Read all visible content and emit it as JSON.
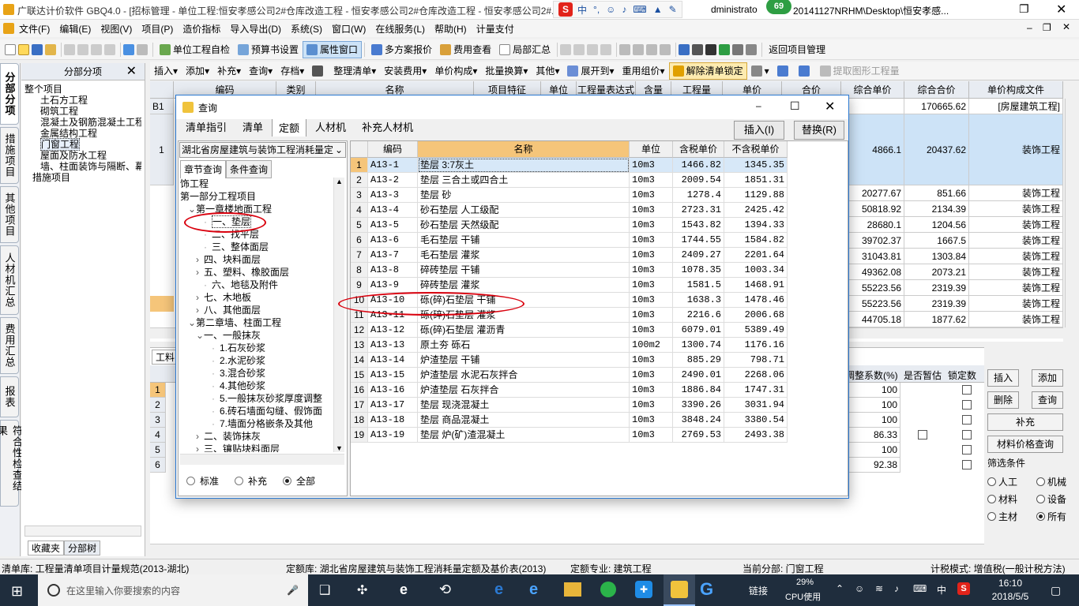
{
  "app": {
    "title": "广联达计价软件 GBQ4.0 - [招标管理 - 单位工程:恒安孝感公司2#仓库改造工程 - 恒安孝感公司2#仓库改造工程 - 恒安孝感公司2#...",
    "title_tail": "dministrato",
    "title_path": "20141127NRHM\\Desktop\\恒安孝感...",
    "badge": "69"
  },
  "menu": [
    "文件(F)",
    "编辑(E)",
    "视图(V)",
    "项目(P)",
    "造价指标",
    "导入导出(D)",
    "系统(S)",
    "窗口(W)",
    "在线服务(L)",
    "帮助(H)",
    "计量支付"
  ],
  "toolbar1": [
    "单位工程自检",
    "预算书设置",
    "属性窗口",
    "多方案报价",
    "费用查看",
    "局部汇总",
    "返回项目管理"
  ],
  "toolbar2": [
    "插入",
    "添加",
    "补充",
    "查询",
    "存档",
    "整理清单",
    "安装费用",
    "单价构成",
    "批量换算",
    "其他",
    "展开到",
    "重用组价",
    "解除清单锁定",
    "提取图形工程量"
  ],
  "vtabs": [
    "分部分项",
    "措施项目",
    "其他项目",
    "人材机汇总",
    "费用汇总",
    "报表",
    "符合性检查结果"
  ],
  "nav": {
    "header": "分部分项",
    "items": [
      "整个项目",
      "土石方工程",
      "砌筑工程",
      "混凝土及钢筋混凝土工程",
      "金属结构工程",
      "门窗工程",
      "屋面及防水工程",
      "墙、柱面装饰与隔断、幕墙工程",
      "措施项目"
    ],
    "bottom_tabs": [
      "收藏夹",
      "分部树"
    ]
  },
  "main_grid": {
    "headers": [
      "编码",
      "类别",
      "名称",
      "项目特征",
      "单位",
      "工程量表达式",
      "含量",
      "工程量",
      "单价",
      "合价",
      "综合单价",
      "综合合价",
      "单价构成文件"
    ],
    "b1_row": {
      "code": "B1",
      "total": "170665.62",
      "file": "[房屋建筑工程]"
    },
    "row1": {
      "num": "1",
      "unit_price": "4866.1",
      "total": "20437.62",
      "file": "装饰工程"
    },
    "rows": [
      {
        "a": "20277.67",
        "b": "851.66",
        "file": "装饰工程"
      },
      {
        "a": "50818.92",
        "b": "2134.39",
        "file": "装饰工程"
      },
      {
        "a": "28680.1",
        "b": "1204.56",
        "file": "装饰工程"
      },
      {
        "a": "39702.37",
        "b": "1667.5",
        "file": "装饰工程"
      },
      {
        "a": "31043.81",
        "b": "1303.84",
        "file": "装饰工程"
      },
      {
        "a": "49362.08",
        "b": "2073.21",
        "file": "装饰工程"
      },
      {
        "a": "55223.56",
        "b": "2319.39",
        "file": "装饰工程"
      },
      {
        "a": "55223.56",
        "b": "2319.39",
        "file": "装饰工程"
      },
      {
        "a": "44705.18",
        "b": "1877.62",
        "file": "装饰工程"
      }
    ]
  },
  "lower": {
    "tab": "工料",
    "headers": [
      "调整系数(%)",
      "是否暂估",
      "锁定数"
    ],
    "rows": [
      {
        "num": "1",
        "coef": "100"
      },
      {
        "num": "2",
        "coef": "100"
      },
      {
        "num": "3",
        "coef": "100"
      },
      {
        "num": "4",
        "coef": "86.33"
      },
      {
        "num": "5",
        "coef": "100"
      },
      {
        "num": "6",
        "coef": "92.38"
      }
    ]
  },
  "right_buttons": {
    "insert": "插入",
    "add": "添加",
    "delete": "删除",
    "query": "查询",
    "supplement": "补充",
    "material_query": "材料价格查询"
  },
  "filter": {
    "title": "筛选条件",
    "options": [
      "人工",
      "机械",
      "材料",
      "设备",
      "主材",
      "所有"
    ],
    "selected": "所有"
  },
  "dialog": {
    "title": "查询",
    "tabs": [
      "清单指引",
      "清单",
      "定额",
      "人材机",
      "补充人材机"
    ],
    "active_tab": "定额",
    "insert_btn": "插入(I)",
    "replace_btn": "替换(R)",
    "combo": "湖北省房屋建筑与装饰工程消耗量定",
    "subtabs": [
      "章节查询",
      "条件查询"
    ],
    "tree": [
      {
        "label": "饰工程",
        "indent": 0,
        "exp": ""
      },
      {
        "label": "第一部分工程项目",
        "indent": 0,
        "exp": ""
      },
      {
        "label": "第一章楼地面工程",
        "indent": 1,
        "exp": "v"
      },
      {
        "label": "一、垫层",
        "indent": 3,
        "exp": ""
      },
      {
        "label": "二、找平层",
        "indent": 3,
        "exp": ""
      },
      {
        "label": "三、整体面层",
        "indent": 3,
        "exp": ""
      },
      {
        "label": "四、块料面层",
        "indent": 2,
        "exp": ">"
      },
      {
        "label": "五、塑料、橡胶面层",
        "indent": 2,
        "exp": ">"
      },
      {
        "label": "六、地毯及附件",
        "indent": 3,
        "exp": ""
      },
      {
        "label": "七、木地板",
        "indent": 2,
        "exp": ">"
      },
      {
        "label": "八、其他面层",
        "indent": 2,
        "exp": ">"
      },
      {
        "label": "第二章墙、柱面工程",
        "indent": 1,
        "exp": "v"
      },
      {
        "label": "一、一般抹灰",
        "indent": 2,
        "exp": "v"
      },
      {
        "label": "1.石灰砂浆",
        "indent": 4,
        "exp": ""
      },
      {
        "label": "2.水泥砂浆",
        "indent": 4,
        "exp": ""
      },
      {
        "label": "3.混合砂浆",
        "indent": 4,
        "exp": ""
      },
      {
        "label": "4.其他砂浆",
        "indent": 4,
        "exp": ""
      },
      {
        "label": "5.一般抹灰砂浆厚度调整",
        "indent": 4,
        "exp": ""
      },
      {
        "label": "6.砖石墙面勾缝、假饰面",
        "indent": 4,
        "exp": ""
      },
      {
        "label": "7.墙面分格嵌条及其他",
        "indent": 4,
        "exp": ""
      },
      {
        "label": "二、装饰抹灰",
        "indent": 2,
        "exp": ">"
      },
      {
        "label": "三、镶贴块料面层",
        "indent": 2,
        "exp": ">"
      }
    ],
    "radios": [
      "标准",
      "补充",
      "全部"
    ],
    "radio_selected": "全部",
    "table_headers": [
      "编码",
      "名称",
      "单位",
      "含税单价",
      "不含税单价"
    ],
    "table_rows": [
      [
        "1",
        "A13-1",
        "垫层 3:7灰土",
        "10m3",
        "1466.82",
        "1345.35"
      ],
      [
        "2",
        "A13-2",
        "垫层 三合土或四合土",
        "10m3",
        "2009.54",
        "1851.31"
      ],
      [
        "3",
        "A13-3",
        "垫层 砂",
        "10m3",
        "1278.4",
        "1129.88"
      ],
      [
        "4",
        "A13-4",
        "砂石垫层 人工级配",
        "10m3",
        "2723.31",
        "2425.42"
      ],
      [
        "5",
        "A13-5",
        "砂石垫层 天然级配",
        "10m3",
        "1543.82",
        "1394.33"
      ],
      [
        "6",
        "A13-6",
        "毛石垫层 干铺",
        "10m3",
        "1744.55",
        "1584.82"
      ],
      [
        "7",
        "A13-7",
        "毛石垫层 灌浆",
        "10m3",
        "2409.27",
        "2201.64"
      ],
      [
        "8",
        "A13-8",
        "碎砖垫层 干铺",
        "10m3",
        "1078.35",
        "1003.34"
      ],
      [
        "9",
        "A13-9",
        "碎砖垫层 灌浆",
        "10m3",
        "1581.5",
        "1468.91"
      ],
      [
        "10",
        "A13-10",
        "砾(碎)石垫层 干铺",
        "10m3",
        "1638.3",
        "1478.46"
      ],
      [
        "11",
        "A13-11",
        "砾(碎)石垫层 灌浆",
        "10m3",
        "2216.6",
        "2006.68"
      ],
      [
        "12",
        "A13-12",
        "砾(碎)石垫层 灌沥青",
        "10m3",
        "6079.01",
        "5389.49"
      ],
      [
        "13",
        "A13-13",
        "原土夯 砾石",
        "100m2",
        "1300.74",
        "1176.16"
      ],
      [
        "14",
        "A13-14",
        "炉渣垫层 干铺",
        "10m3",
        "885.29",
        "798.71"
      ],
      [
        "15",
        "A13-15",
        "炉渣垫层 水泥石灰拌合",
        "10m3",
        "2490.01",
        "2268.06"
      ],
      [
        "16",
        "A13-16",
        "炉渣垫层 石灰拌合",
        "10m3",
        "1886.84",
        "1747.31"
      ],
      [
        "17",
        "A13-17",
        "垫层 现浇混凝土",
        "10m3",
        "3390.26",
        "3031.94"
      ],
      [
        "18",
        "A13-18",
        "垫层 商品混凝土",
        "10m3",
        "3848.24",
        "3380.54"
      ],
      [
        "19",
        "A13-19",
        "垫层 炉(矿)渣混凝土",
        "10m3",
        "2769.53",
        "2493.38"
      ]
    ]
  },
  "status": {
    "list_lib": "清单库: 工程量清单项目计量规范(2013-湖北)",
    "quota_lib": "定额库: 湖北省房屋建筑与装饰工程消耗量定额及基价表(2013)",
    "quota_major": "定额专业: 建筑工程",
    "current": "当前分部: 门窗工程",
    "tax_mode": "计税模式: 增值税(一般计税方法)"
  },
  "taskbar": {
    "search_placeholder": "在这里输入你要搜索的内容",
    "link": "链接",
    "cpu_pct": "29%",
    "cpu_label": "CPU使用",
    "ime": "中",
    "time": "16:10",
    "date": "2018/5/5"
  },
  "colors": {
    "accent": "#2b79d2",
    "header_orange": "#f5c57a",
    "selected_blue": "#cde3f7",
    "taskbar": "#1f2d3d",
    "annotation_red": "#d9000d"
  }
}
